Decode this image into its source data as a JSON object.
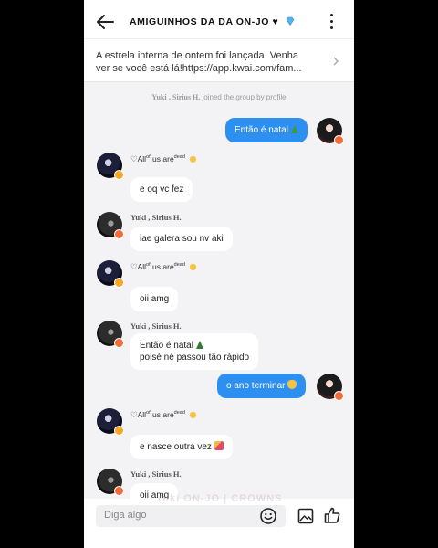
{
  "header": {
    "title": "AMIGUINHOS DA DA ON-JO ♥"
  },
  "announcement": {
    "line1": "A estrela interna de ontem foi lançada. Venha",
    "line2": "ver se você está lá!https://app.kwai.com/fam..."
  },
  "system_notice": {
    "name1": "Yuki",
    "sep": ",",
    "name2": "Sirius H.",
    "text": "joined the group by profile"
  },
  "messages": [
    {
      "side": "out",
      "text": "Então é natal"
    },
    {
      "side": "in",
      "sender_main": "♡All",
      "sender_sup1": "of",
      "sender_mid": "us are",
      "sender_sup2": "dead",
      "text": "e oq vc fez"
    },
    {
      "side": "in",
      "sender": "Yuki ,  Sirius H.",
      "text": "iae galera sou nv aki"
    },
    {
      "side": "in",
      "sender_main": "♡All",
      "sender_sup1": "of",
      "sender_mid": "us are",
      "sender_sup2": "dead",
      "text": "oii amg"
    },
    {
      "side": "in",
      "sender": "Yuki ,  Sirius H.",
      "text_line1": "Então é natal",
      "text_line2": "poisé né passou tão rápido"
    },
    {
      "side": "out",
      "text": "o ano terminar"
    },
    {
      "side": "in",
      "sender_main": "♡All",
      "sender_sup1": "of",
      "sender_mid": "us are",
      "sender_sup2": "dead",
      "text": "e nasce outra vez"
    },
    {
      "side": "in",
      "sender": "Yuki ,  Sirius H.",
      "text": "oii amg"
    }
  ],
  "watermark": "Yuki ON-JO  |  CROWNS",
  "input": {
    "placeholder": "Diga algo"
  },
  "icons": [
    "back-arrow-icon",
    "gem-icon",
    "more-vertical-icon",
    "chevron-right-icon",
    "emoji-icon",
    "image-icon",
    "thumbs-up-icon"
  ],
  "colors": {
    "outgoing_bubble": "#2d8ff0",
    "chat_background": "#f3f3f5",
    "badge_orange": "#f26b3a",
    "badge_yellow": "#f5a623"
  }
}
